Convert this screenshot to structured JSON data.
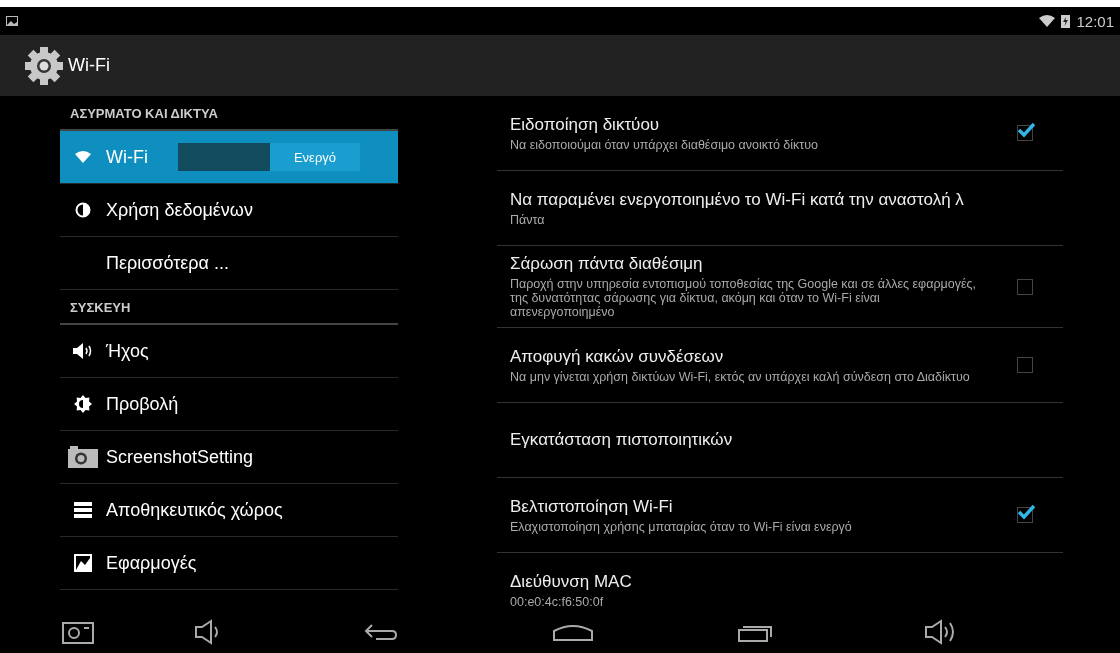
{
  "status_bar": {
    "time": "12:01"
  },
  "action_bar": {
    "title": "Wi-Fi"
  },
  "sidebar": {
    "sections": [
      {
        "header": "ΑΣΥΡΜΑΤΟ ΚΑΙ ΔΙΚΤΥΑ",
        "items": [
          {
            "label": "Wi-Fi",
            "selected": true,
            "switch": {
              "label": "Ενεργό",
              "on": true
            }
          },
          {
            "label": "Χρήση δεδομένων",
            "selected": false
          },
          {
            "label": "Περισσότερα ...",
            "selected": false
          }
        ]
      },
      {
        "header": "ΣΥΣΚΕΥΗ",
        "items": [
          {
            "label": "Ήχος",
            "selected": false
          },
          {
            "label": "Προβολή",
            "selected": false
          },
          {
            "label": "ScreenshotSetting",
            "selected": false
          },
          {
            "label": "Αποθηκευτικός χώρος",
            "selected": false
          },
          {
            "label": "Εφαρμογές",
            "selected": false
          }
        ]
      }
    ]
  },
  "settings": [
    {
      "kind": "checkbox",
      "title": "Ειδοποίηση δικτύου",
      "summary": "Να ειδοποιούμαι όταν υπάρχει διαθέσιμο ανοικτό δίκτυο",
      "checked": true
    },
    {
      "kind": "plain",
      "title": "Να παραμένει ενεργοποιημένο το Wi-Fi κατά την αναστολή λ",
      "summary": "Πάντα"
    },
    {
      "kind": "checkbox",
      "title": "Σάρωση πάντα διαθέσιμη",
      "summary": "Παροχή στην υπηρεσία εντοπισμού τοποθεσίας της Google και σε άλλες εφαρμογές, της δυνατότητας σάρωσης για δίκτυα, ακόμη και όταν το Wi-Fi είναι απενεργοποιημένο",
      "checked": false
    },
    {
      "kind": "checkbox",
      "title": "Αποφυγή κακών συνδέσεων",
      "summary": "Να μην γίνεται χρήση δικτύων Wi-Fi, εκτός αν υπάρχει καλή σύνδεση στο Διαδίκτυο",
      "checked": false
    },
    {
      "kind": "plain",
      "title": "Εγκατάσταση πιστοποιητικών"
    },
    {
      "kind": "checkbox",
      "title": "Βελτιστοποίηση Wi-Fi",
      "summary": "Ελαχιστοποίηση χρήσης μπαταρίας όταν το Wi-Fi είναι ενεργό",
      "checked": true
    },
    {
      "kind": "plain",
      "title": "Διεύθυνση MAC",
      "summary": "00:e0:4c:f6:50:0f"
    }
  ]
}
